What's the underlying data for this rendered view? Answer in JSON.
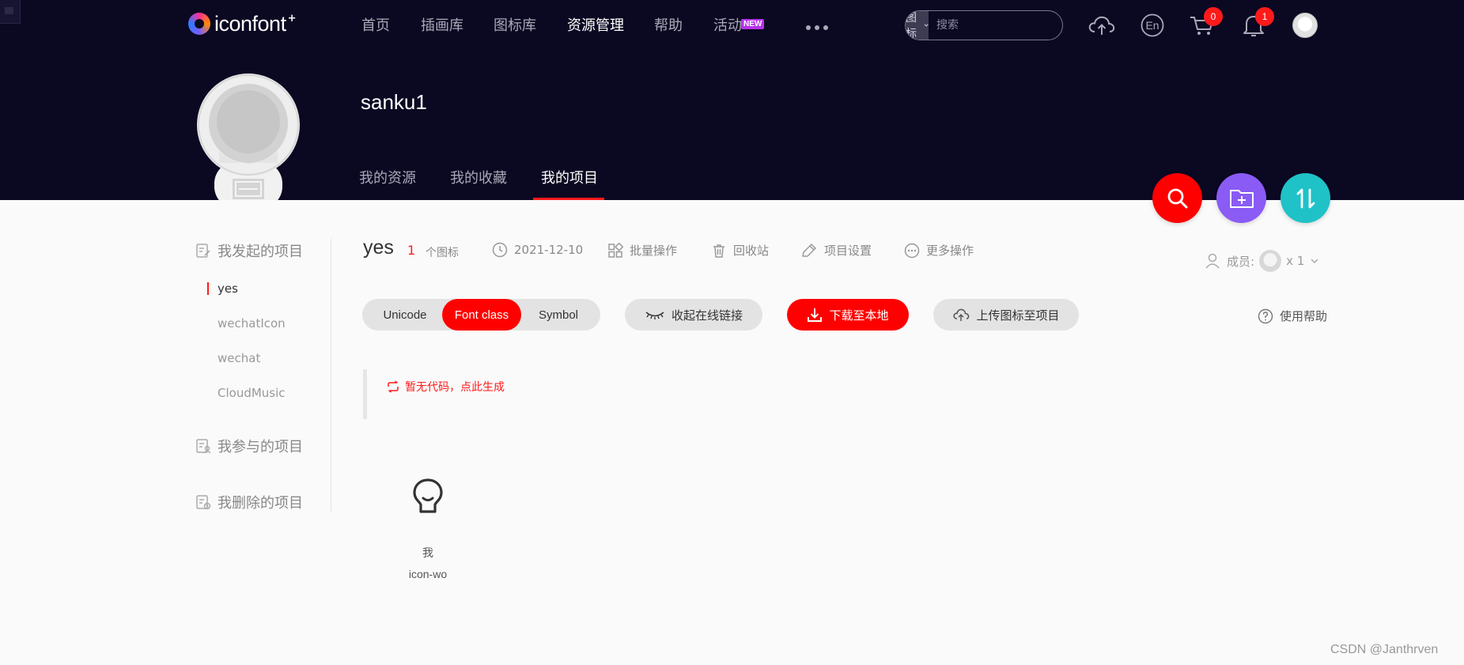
{
  "brand": {
    "name": "iconfont",
    "mark": "+"
  },
  "nav": {
    "items": [
      "首页",
      "插画库",
      "图标库",
      "资源管理",
      "帮助",
      "活动"
    ],
    "active": "资源管理",
    "new_badge": "NEW"
  },
  "search": {
    "type": "图标",
    "placeholder": "搜索"
  },
  "header": {
    "language": "En",
    "cart_count": "0",
    "notification_count": "1"
  },
  "profile": {
    "username": "sanku1",
    "tabs": [
      "我的资源",
      "我的收藏",
      "我的项目"
    ],
    "active_tab": "我的项目"
  },
  "sidebar": {
    "created_group": "我发起的项目",
    "projects": [
      "yes",
      "wechatIcon",
      "wechat",
      "CloudMusic"
    ],
    "active_project": "yes",
    "joined_group": "我参与的项目",
    "deleted_group": "我删除的项目"
  },
  "project": {
    "name": "yes",
    "icon_count": "1",
    "icon_count_label": "个图标",
    "date": "2021-12-10",
    "actions": [
      "批量操作",
      "回收站",
      "项目设置",
      "更多操作"
    ],
    "members_label": "成员:",
    "members_count": "x 1"
  },
  "toolbar": {
    "formats": [
      "Unicode",
      "Font class",
      "Symbol"
    ],
    "active_format": "Font class",
    "collapse_link": "收起在线链接",
    "download": "下载至本地",
    "upload": "上传图标至项目",
    "help": "使用帮助"
  },
  "code": {
    "empty_message": "暂无代码，点此生成"
  },
  "icons": [
    {
      "name": "我",
      "code": "icon-wo"
    }
  ],
  "watermark": "CSDN @Janthrven",
  "colors": {
    "header_bg": "#0b0822",
    "accent": "#ff0000",
    "fab_folder": "#8a5bf5",
    "fab_sort": "#1fc2c7"
  }
}
